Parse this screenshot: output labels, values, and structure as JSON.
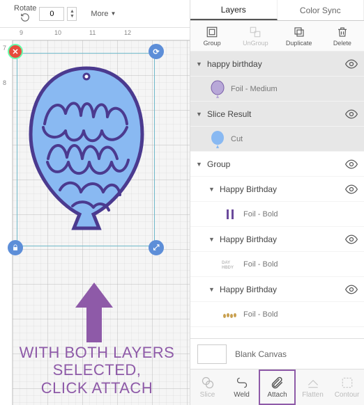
{
  "toolbar": {
    "rotate_label": "Rotate",
    "rotate_value": "0",
    "more_label": "More"
  },
  "ruler": {
    "h9": "9",
    "h10": "10",
    "h11": "11",
    "h12": "12",
    "v7": "7",
    "v8": "8"
  },
  "annotation": {
    "line1": "WITH BOTH LAYERS",
    "line2": "SELECTED,",
    "line3": "CLICK ATTACH"
  },
  "tabs": {
    "layers": "Layers",
    "colorsync": "Color Sync"
  },
  "actions": {
    "group": "Group",
    "ungroup": "UnGroup",
    "duplicate": "Duplicate",
    "delete": "Delete"
  },
  "layers": [
    {
      "name": "happy birthday",
      "sub": "Foil - Medium"
    },
    {
      "name": "Slice Result",
      "sub": "Cut"
    },
    {
      "name": "Group",
      "children": [
        {
          "name": "Happy Birthday",
          "sub": "Foil - Bold"
        },
        {
          "name": "Happy Birthday",
          "sub": "Foil - Bold"
        },
        {
          "name": "Happy Birthday",
          "sub": "Foil - Bold"
        }
      ]
    }
  ],
  "canvas": {
    "label": "Blank Canvas"
  },
  "bottom": {
    "slice": "Slice",
    "weld": "Weld",
    "attach": "Attach",
    "flatten": "Flatten",
    "contour": "Contour"
  }
}
